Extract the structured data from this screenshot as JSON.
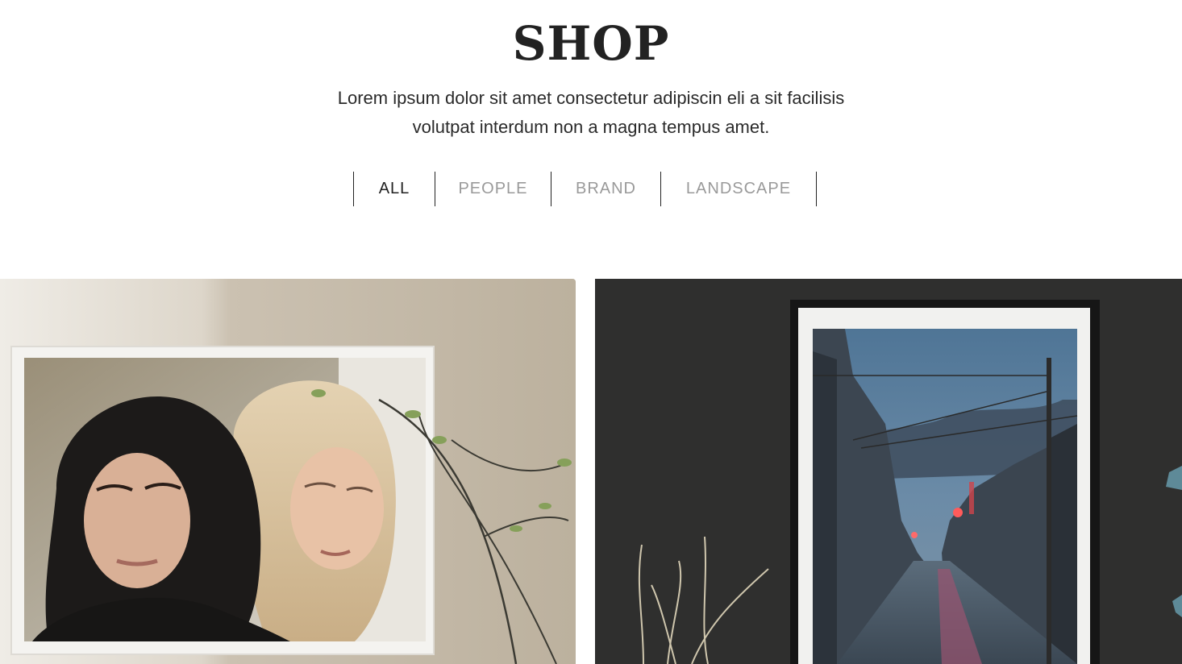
{
  "header": {
    "title": "SHOP",
    "description": "Lorem ipsum dolor sit amet consectetur adipiscin eli a sit facilisis volutpat interdum non a magna tempus amet."
  },
  "filters": {
    "items": [
      {
        "label": "ALL",
        "active": true
      },
      {
        "label": "PEOPLE",
        "active": false
      },
      {
        "label": "BRAND",
        "active": false
      },
      {
        "label": "LANDSCAPE",
        "active": false
      }
    ]
  },
  "gallery": {
    "items": [
      {
        "category": "people",
        "subject": "framed portrait of two women"
      },
      {
        "category": "landscape",
        "subject": "framed photo of an evening village street"
      }
    ]
  },
  "colors": {
    "text": "#222222",
    "inactive_filter": "#9a9a9a",
    "background": "#ffffff"
  }
}
